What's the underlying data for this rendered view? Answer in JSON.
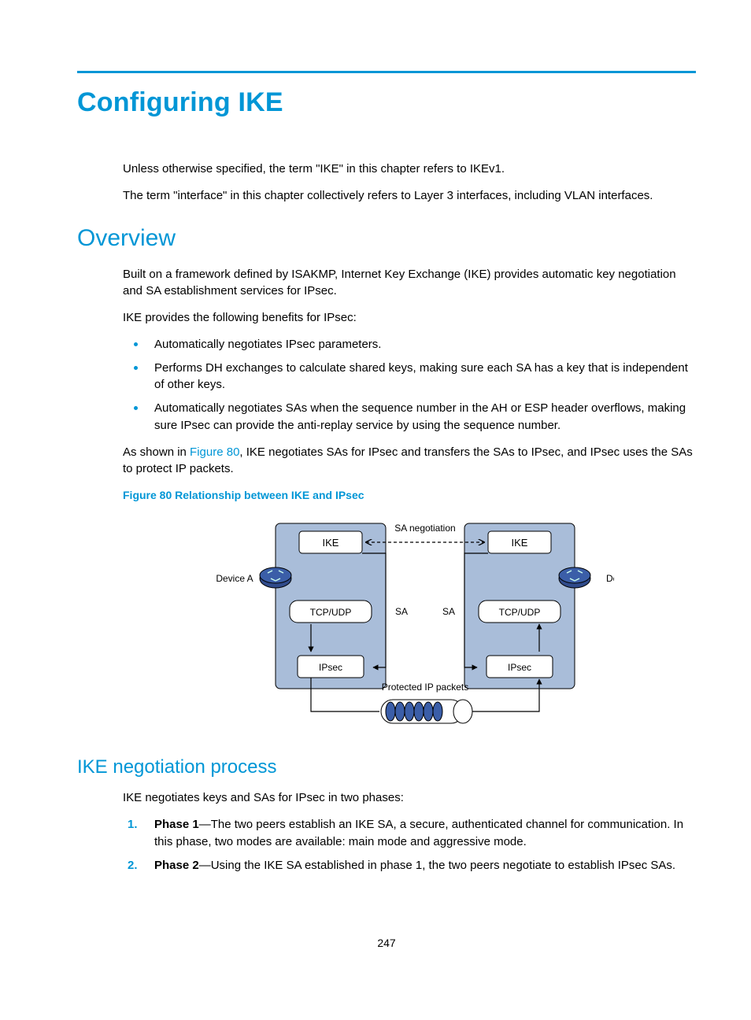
{
  "chapter_title": "Configuring IKE",
  "intro": {
    "p1": "Unless otherwise specified, the term \"IKE\" in this chapter refers to IKEv1.",
    "p2": "The term \"interface\" in this chapter collectively refers to Layer 3 interfaces, including VLAN interfaces."
  },
  "overview": {
    "heading": "Overview",
    "p1": "Built on a framework defined by ISAKMP, Internet Key Exchange (IKE) provides automatic key negotiation and SA establishment services for IPsec.",
    "p2": "IKE provides the following benefits for IPsec:",
    "bullets": [
      "Automatically negotiates IPsec parameters.",
      "Performs DH exchanges to calculate shared keys, making sure each SA has a key that is independent of other keys.",
      "Automatically negotiates SAs when the sequence number in the AH or ESP header overflows, making sure IPsec can provide the anti-replay service by using the sequence number."
    ],
    "p3_pre": "As shown in ",
    "p3_ref": "Figure 80",
    "p3_post": ", IKE negotiates SAs for IPsec and transfers the SAs to IPsec, and IPsec uses the SAs to protect IP packets.",
    "figure_caption": "Figure 80 Relationship between IKE and IPsec",
    "diagram": {
      "ike_left": "IKE",
      "ike_right": "IKE",
      "sa_negotiation": "SA negotiation",
      "device_a": "Device A",
      "device_b": "Device B",
      "tcpudp_left": "TCP/UDP",
      "tcpudp_right": "TCP/UDP",
      "sa_left": "SA",
      "sa_right": "SA",
      "ipsec_left": "IPsec",
      "ipsec_right": "IPsec",
      "protected_packets": "Protected IP packets"
    }
  },
  "negotiation": {
    "heading": "IKE negotiation process",
    "p1": "IKE negotiates keys and SAs for IPsec in two phases:",
    "phase1_label": "Phase 1",
    "phase1_text": "—The two peers establish an IKE SA, a secure, authenticated channel for communication. In this phase, two modes are available: main mode and aggressive mode.",
    "phase2_label": "Phase 2",
    "phase2_text": "—Using the IKE SA established in phase 1, the two peers negotiate to establish IPsec SAs."
  },
  "page_number": "247"
}
